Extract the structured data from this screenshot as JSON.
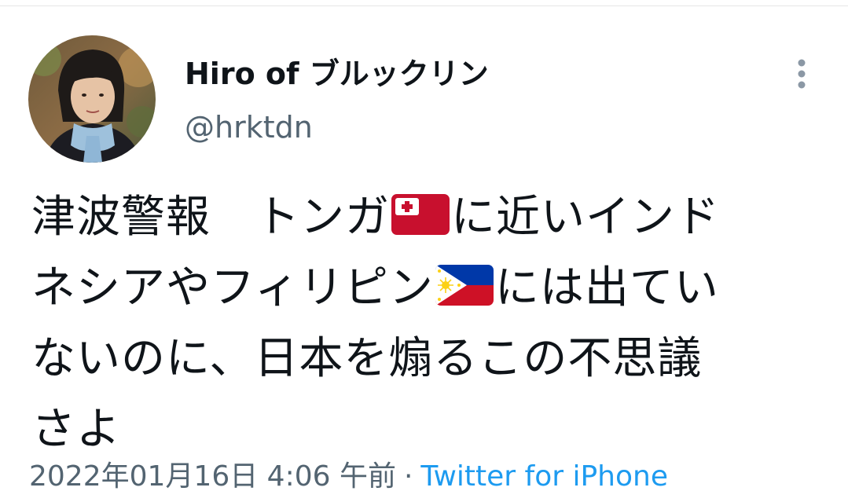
{
  "author": {
    "display_name": "Hiro of ブルックリン",
    "username": "@hrktdn"
  },
  "tweet": {
    "lines": [
      [
        "津波警報　トンガ",
        "に近いインド"
      ],
      [
        "ネシアやフィリピン",
        "には出てい"
      ],
      [
        "ないのに、日本を煽るこの不思議"
      ],
      [
        "さよ"
      ]
    ],
    "flags": [
      "tonga-flag",
      "philippines-flag"
    ]
  },
  "meta": {
    "timestamp": "2022年01月16日 4:06 午前",
    "separator": "·",
    "source": "Twitter for iPhone"
  },
  "colors": {
    "text": "#0f1419",
    "secondary": "#536471",
    "link": "#1d9bf0"
  },
  "icons": {
    "more": "more-vertical-icon"
  }
}
